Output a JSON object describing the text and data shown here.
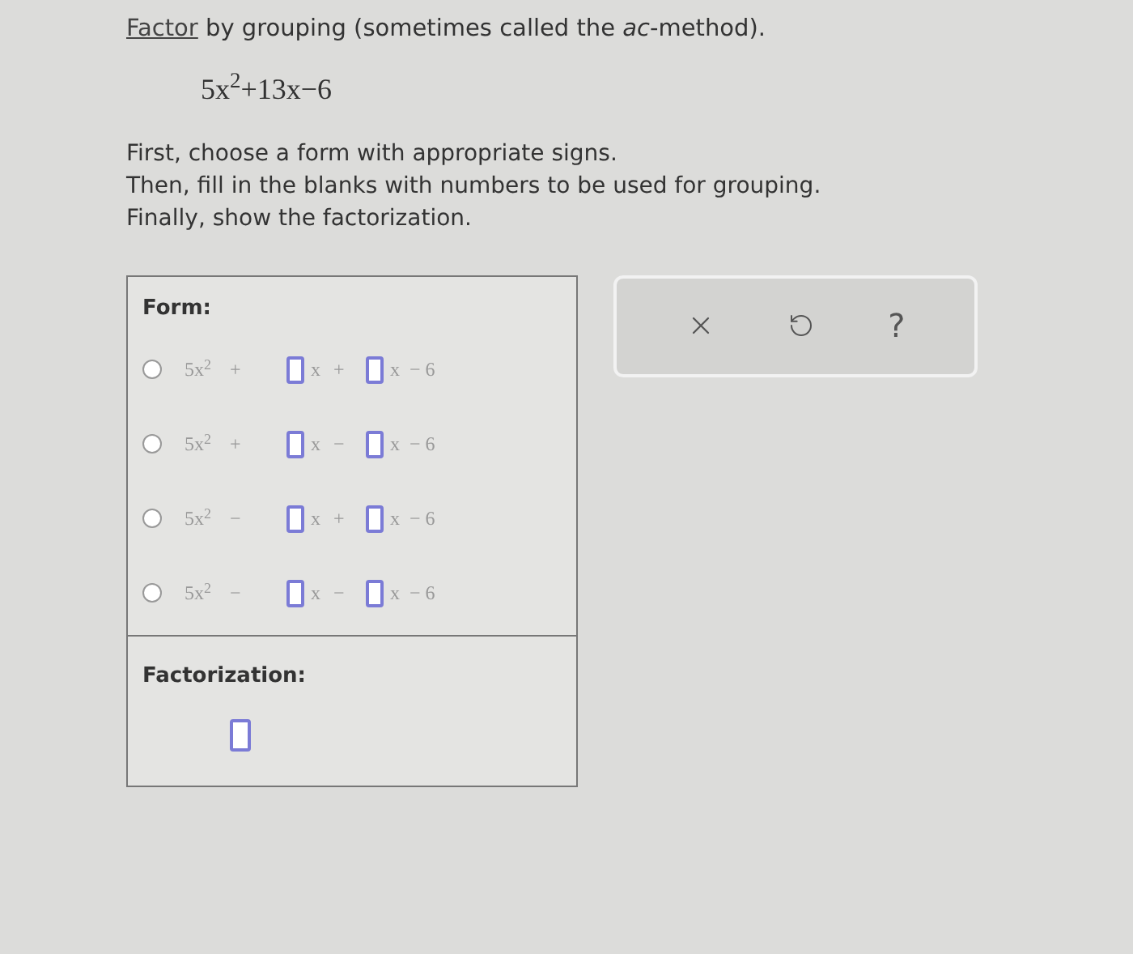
{
  "heading": {
    "link": "Factor",
    "rest": "by grouping (sometimes called the *ac*-method)."
  },
  "expression": "5x$^{2}$+13x−6",
  "steps": [
    "First, choose a form with appropriate signs.",
    "Then, fill in the blanks with numbers to be used for grouping.",
    "Finally, show the factorization."
  ],
  "form": {
    "label": "Form:",
    "options": [
      {
        "selected": false,
        "lead": "5x$^{2}$",
        "sign1": "+",
        "x1": "x",
        "sign2": "+",
        "x2": "x",
        "tail": "− 6"
      },
      {
        "selected": false,
        "lead": "5x$^{2}$",
        "sign1": "+",
        "x1": "x",
        "sign2": "−",
        "x2": "x",
        "tail": "− 6"
      },
      {
        "selected": false,
        "lead": "5x$^{2}$",
        "sign1": "−",
        "x1": "x",
        "sign2": "+",
        "x2": "x",
        "tail": "− 6"
      },
      {
        "selected": false,
        "lead": "5x$^{2}$",
        "sign1": "−",
        "x1": "x",
        "sign2": "−",
        "x2": "x",
        "tail": "− 6"
      }
    ]
  },
  "factorization": {
    "label": "Factorization:"
  },
  "tools": {
    "help": "?"
  }
}
